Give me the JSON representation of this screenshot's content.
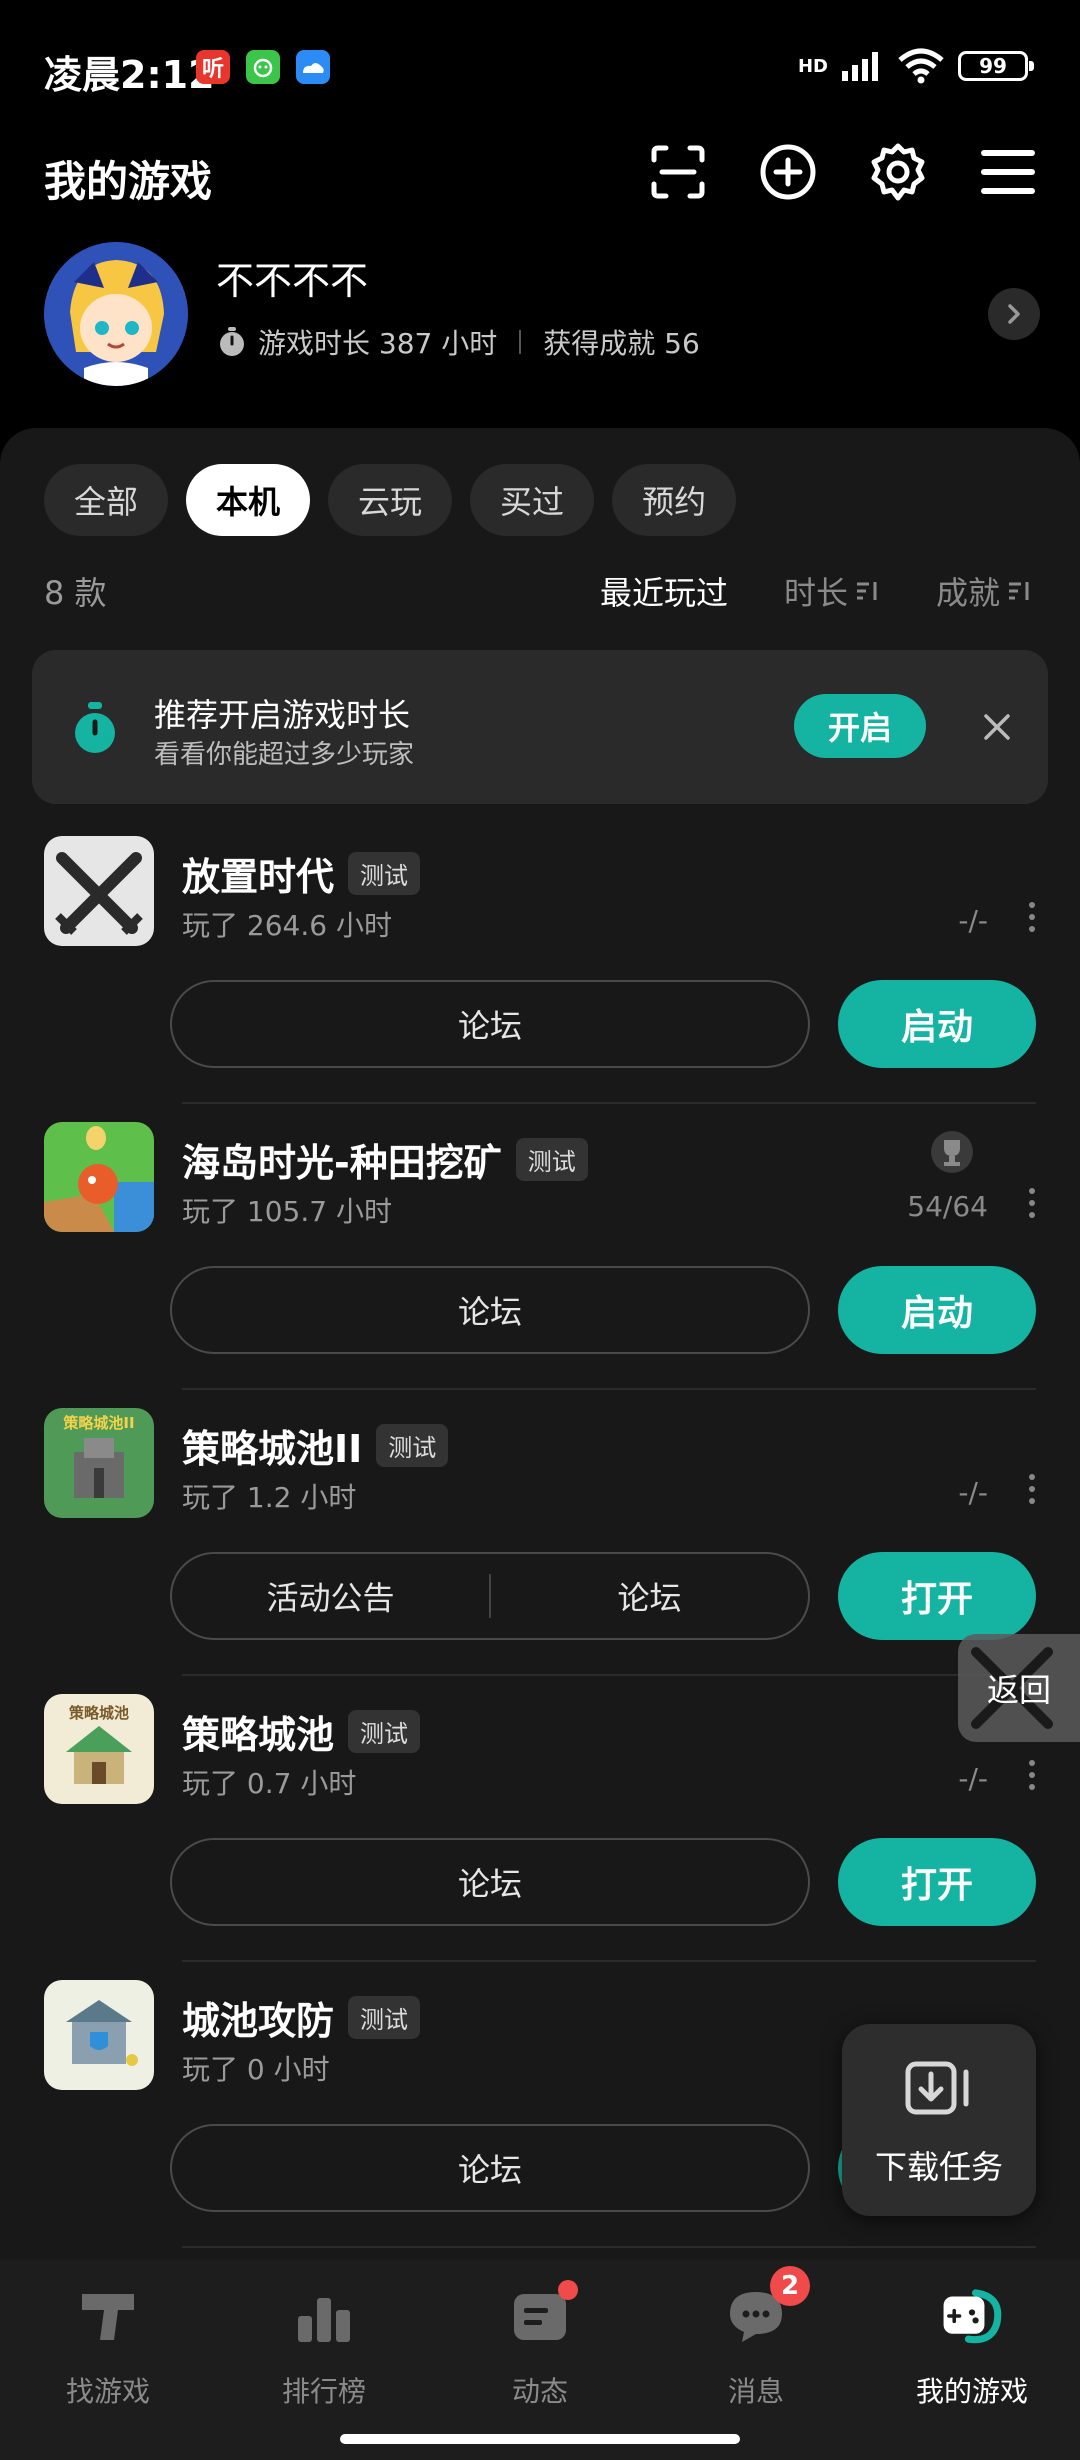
{
  "status": {
    "time": "凌晨2:12",
    "app_badge_1": "听",
    "network": "HD",
    "battery": "99"
  },
  "header": {
    "title": "我的游戏"
  },
  "profile": {
    "name": "不不不不",
    "playtime": "游戏时长 387 小时",
    "achievements": "获得成就 56"
  },
  "tabs": [
    "全部",
    "本机",
    "云玩",
    "买过",
    "预约"
  ],
  "list": {
    "count": "8 款",
    "sort_recent": "最近玩过",
    "sort_time": "时长",
    "sort_ach": "成就"
  },
  "banner": {
    "title": "推荐开启游戏时长",
    "subtitle": "看看你能超过多少玩家",
    "button": "开启"
  },
  "games": [
    {
      "name": "放置时代",
      "badge": "测试",
      "time": "玩了 264.6 小时",
      "ach": "-/-",
      "btn1": "论坛",
      "action": "启动"
    },
    {
      "name": "海岛时光-种田挖矿",
      "badge": "测试",
      "time": "玩了 105.7 小时",
      "ach": "54/64",
      "btn1": "论坛",
      "action": "启动"
    },
    {
      "name": "策略城池II",
      "badge": "测试",
      "time": "玩了 1.2 小时",
      "ach": "-/-",
      "btn0": "活动公告",
      "btn1": "论坛",
      "action": "打开"
    },
    {
      "name": "策略城池",
      "badge": "测试",
      "time": "玩了 0.7 小时",
      "ach": "-/-",
      "btn1": "论坛",
      "action": "打开"
    },
    {
      "name": "城池攻防",
      "badge": "测试",
      "time": "玩了 0 小时",
      "btn1": "论坛"
    }
  ],
  "game_icon_text": {
    "g3": "策略城池II",
    "g4": "策略城池"
  },
  "floating": {
    "return": "返回",
    "download": "下载任务"
  },
  "nav": [
    {
      "label": "找游戏"
    },
    {
      "label": "排行榜"
    },
    {
      "label": "动态"
    },
    {
      "label": "消息",
      "badge": "2"
    },
    {
      "label": "我的游戏"
    }
  ],
  "colors": {
    "accent": "#14b3a2",
    "background": "#000000",
    "card": "#181818",
    "badge_red": "#f04a4a"
  }
}
